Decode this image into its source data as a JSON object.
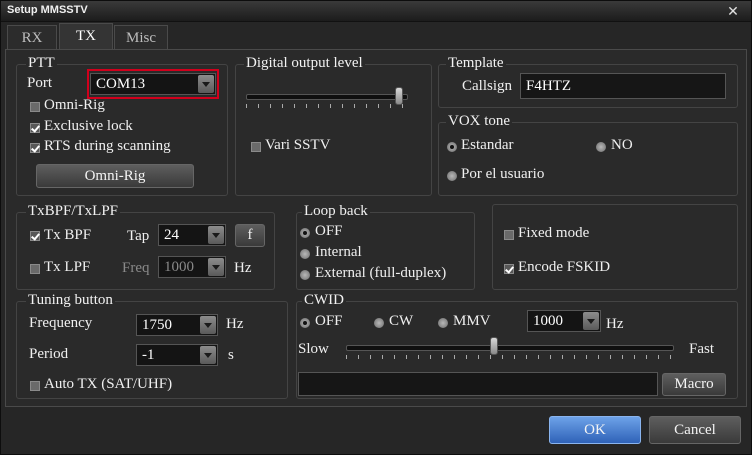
{
  "window": {
    "title": "Setup MMSSTV",
    "close": "✕"
  },
  "tabs": [
    {
      "label": "RX"
    },
    {
      "label": "TX"
    },
    {
      "label": "Misc"
    }
  ],
  "ptt": {
    "title": "PTT",
    "port_label": "Port",
    "port_value": "COM13",
    "omni_rig_check": "Omni-Rig",
    "exclusive_lock": "Exclusive lock",
    "rts_scanning": "RTS during scanning",
    "omni_rig_button": "Omni-Rig"
  },
  "digital_output": {
    "title": "Digital output level",
    "vari_sstv": "Vari SSTV"
  },
  "template": {
    "title": "Template",
    "callsign_label": "Callsign",
    "callsign_value": "F4HTZ"
  },
  "vox": {
    "title": "VOX tone",
    "estandar": "Estandar",
    "no": "NO",
    "usuario": "Por el usuario"
  },
  "txbpf": {
    "title": "TxBPF/TxLPF",
    "tx_bpf": "Tx BPF",
    "tap_label": "Tap",
    "tap_value": "24",
    "f_button": "f",
    "tx_lpf": "Tx LPF",
    "freq_label": "Freq",
    "freq_value": "1000",
    "hz": "Hz"
  },
  "loopback": {
    "title": "Loop back",
    "off": "OFF",
    "internal": "Internal",
    "external": "External (full-duplex)"
  },
  "mode": {
    "fixed": "Fixed mode",
    "encode": "Encode FSKID"
  },
  "tuning": {
    "title": "Tuning button",
    "frequency_label": "Frequency",
    "frequency_value": "1750",
    "hz": "Hz",
    "period_label": "Period",
    "period_value": "-1",
    "s": "s",
    "auto_tx": "Auto TX (SAT/UHF)"
  },
  "cwid": {
    "title": "CWID",
    "off": "OFF",
    "cw": "CW",
    "mmv": "MMV",
    "speed_value": "1000",
    "hz": "Hz",
    "slow": "Slow",
    "fast": "Fast",
    "macro_button": "Macro",
    "text_value": ""
  },
  "footer": {
    "ok": "OK",
    "cancel": "Cancel"
  }
}
